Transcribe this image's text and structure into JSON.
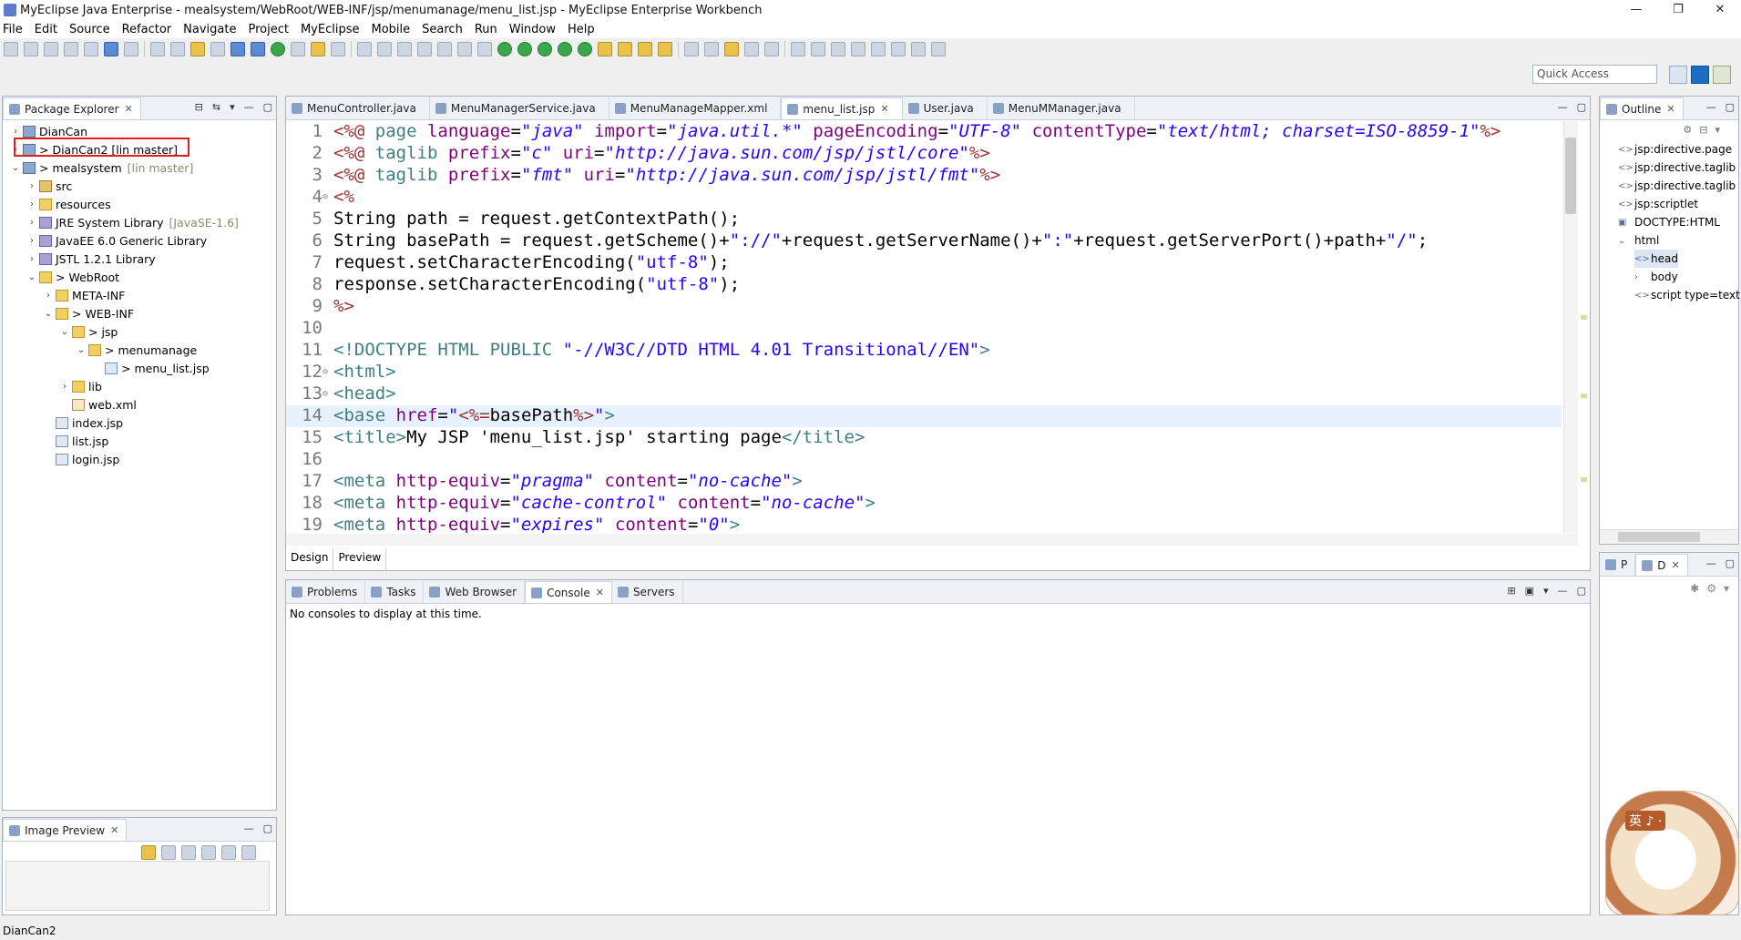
{
  "window": {
    "title": "MyEclipse Java Enterprise - mealsystem/WebRoot/WEB-INF/jsp/menumanage/menu_list.jsp - MyEclipse Enterprise Workbench",
    "controls": [
      "—",
      "❐",
      "✕"
    ]
  },
  "menu": [
    "File",
    "Edit",
    "Source",
    "Refactor",
    "Navigate",
    "Project",
    "MyEclipse",
    "Mobile",
    "Search",
    "Run",
    "Window",
    "Help"
  ],
  "quick_access": "Quick Access",
  "package_explorer": {
    "tab_label": "Package Explorer",
    "rows": [
      {
        "arrow": "›",
        "text": "DianCan",
        "suffix": ""
      },
      {
        "arrow": "›",
        "text": "> DianCan2  [lin master]",
        "suffix": ""
      },
      {
        "arrow": "⌄",
        "text": "> mealsystem",
        "suffix": "[lin master]"
      },
      {
        "arrow": "›",
        "text": "src",
        "suffix": ""
      },
      {
        "arrow": "›",
        "text": "resources",
        "suffix": ""
      },
      {
        "arrow": "›",
        "text": "JRE System Library",
        "suffix": "[JavaSE-1.6]"
      },
      {
        "arrow": "›",
        "text": "JavaEE 6.0 Generic Library",
        "suffix": ""
      },
      {
        "arrow": "›",
        "text": "JSTL 1.2.1 Library",
        "suffix": ""
      },
      {
        "arrow": "⌄",
        "text": "> WebRoot",
        "suffix": ""
      },
      {
        "arrow": "›",
        "text": "META-INF",
        "suffix": ""
      },
      {
        "arrow": "⌄",
        "text": "> WEB-INF",
        "suffix": ""
      },
      {
        "arrow": "⌄",
        "text": "> jsp",
        "suffix": ""
      },
      {
        "arrow": "⌄",
        "text": "> menumanage",
        "suffix": ""
      },
      {
        "arrow": "",
        "text": "> menu_list.jsp",
        "suffix": ""
      },
      {
        "arrow": "›",
        "text": "lib",
        "suffix": ""
      },
      {
        "arrow": "",
        "text": "web.xml",
        "suffix": ""
      },
      {
        "arrow": "",
        "text": "index.jsp",
        "suffix": ""
      },
      {
        "arrow": "",
        "text": "list.jsp",
        "suffix": ""
      },
      {
        "arrow": "",
        "text": "login.jsp",
        "suffix": ""
      }
    ]
  },
  "image_preview": {
    "tab_label": "Image Preview"
  },
  "editor": {
    "tabs": [
      {
        "label": "MenuController.java",
        "active": false
      },
      {
        "label": "MenuManagerService.java",
        "active": false
      },
      {
        "label": "MenuManageMapper.xml",
        "active": false
      },
      {
        "label": "menu_list.jsp",
        "active": true
      },
      {
        "label": "User.java",
        "active": false
      },
      {
        "label": "MenuMManager.java",
        "active": false
      }
    ],
    "bottom_tabs": [
      "Design",
      "Preview"
    ],
    "current_line": 14,
    "lines": [
      {
        "n": "1",
        "fold": "",
        "segs": [
          [
            "dir",
            "<%@ "
          ],
          [
            "kw",
            "page "
          ],
          [
            "attr",
            "language"
          ],
          [
            "",
            "="
          ],
          [
            "str",
            "\"java\""
          ],
          [
            "",
            " "
          ],
          [
            "attr",
            "import"
          ],
          [
            "",
            "="
          ],
          [
            "str",
            "\"java.util.*\""
          ],
          [
            "",
            " "
          ],
          [
            "attr",
            "pageEncoding"
          ],
          [
            "",
            "="
          ],
          [
            "str",
            "\"UTF-8\""
          ],
          [
            "",
            " "
          ],
          [
            "attr",
            "contentType"
          ],
          [
            "",
            "="
          ],
          [
            "str",
            "\"text/html; charset=ISO-8859-1\""
          ],
          [
            "dir",
            "%>"
          ]
        ]
      },
      {
        "n": "2",
        "fold": "",
        "segs": [
          [
            "dir",
            "<%@ "
          ],
          [
            "kw",
            "taglib "
          ],
          [
            "attr",
            "prefix"
          ],
          [
            "",
            "="
          ],
          [
            "str",
            "\"c\""
          ],
          [
            "",
            " "
          ],
          [
            "attr",
            "uri"
          ],
          [
            "",
            "="
          ],
          [
            "str",
            "\"http://java.sun.com/jsp/jstl/core\""
          ],
          [
            "dir",
            "%>"
          ]
        ]
      },
      {
        "n": "3",
        "fold": "",
        "segs": [
          [
            "dir",
            "<%@ "
          ],
          [
            "kw",
            "taglib "
          ],
          [
            "attr",
            "prefix"
          ],
          [
            "",
            "="
          ],
          [
            "str",
            "\"fmt\""
          ],
          [
            "",
            " "
          ],
          [
            "attr",
            "uri"
          ],
          [
            "",
            "="
          ],
          [
            "str",
            "\"http://java.sun.com/jsp/jstl/fmt\""
          ],
          [
            "dir",
            "%>"
          ]
        ]
      },
      {
        "n": "4",
        "fold": "⊖",
        "segs": [
          [
            "dir",
            "<%"
          ]
        ]
      },
      {
        "n": "5",
        "fold": "",
        "segs": [
          [
            "",
            "String path = request.getContextPath();"
          ]
        ]
      },
      {
        "n": "6",
        "fold": "",
        "segs": [
          [
            "",
            "String basePath = request.getScheme()+"
          ],
          [
            "str2",
            "\"://\""
          ],
          [
            "",
            "+request.getServerName()+"
          ],
          [
            "str2",
            "\":\""
          ],
          [
            "",
            "+request.getServerPort()+path+"
          ],
          [
            "str2",
            "\"/\""
          ],
          [
            "",
            ";"
          ]
        ]
      },
      {
        "n": "7",
        "fold": "",
        "segs": [
          [
            "",
            "request.setCharacterEncoding("
          ],
          [
            "str2",
            "\"utf-8\""
          ],
          [
            "",
            ");"
          ]
        ]
      },
      {
        "n": "8",
        "fold": "",
        "segs": [
          [
            "",
            "response.setCharacterEncoding("
          ],
          [
            "str2",
            "\"utf-8\""
          ],
          [
            "",
            ");"
          ]
        ]
      },
      {
        "n": "9",
        "fold": "",
        "segs": [
          [
            "dir",
            "%>"
          ]
        ]
      },
      {
        "n": "10",
        "fold": "",
        "segs": [
          [
            "",
            ""
          ]
        ]
      },
      {
        "n": "11",
        "fold": "",
        "segs": [
          [
            "dt",
            "<!DOCTYPE HTML PUBLIC "
          ],
          [
            "str2",
            "\"-//W3C//DTD HTML 4.01 Transitional//EN\""
          ],
          [
            "dt",
            ">"
          ]
        ]
      },
      {
        "n": "12",
        "fold": "⊖",
        "segs": [
          [
            "tag",
            "<html>"
          ]
        ]
      },
      {
        "n": "13",
        "fold": "⊖",
        "segs": [
          [
            "tag",
            "<head>"
          ]
        ]
      },
      {
        "n": "14",
        "fold": "",
        "segs": [
          [
            "tag",
            "<base "
          ],
          [
            "attr",
            "href"
          ],
          [
            "",
            "="
          ],
          [
            "str2",
            "\""
          ],
          [
            "dir",
            "<%="
          ],
          [
            "",
            "basePath"
          ],
          [
            "dir",
            "%>"
          ],
          [
            "str2",
            "\""
          ],
          [
            "tag",
            ">"
          ]
        ]
      },
      {
        "n": "15",
        "fold": "",
        "segs": [
          [
            "tag",
            "<title>"
          ],
          [
            "",
            "My JSP 'menu_list.jsp' starting page"
          ],
          [
            "tag",
            "</title>"
          ]
        ]
      },
      {
        "n": "16",
        "fold": "",
        "segs": [
          [
            "",
            ""
          ]
        ]
      },
      {
        "n": "17",
        "fold": "",
        "segs": [
          [
            "tag",
            "<meta "
          ],
          [
            "attr",
            "http-equiv"
          ],
          [
            "",
            "="
          ],
          [
            "str",
            "\"pragma\""
          ],
          [
            "",
            " "
          ],
          [
            "attr",
            "content"
          ],
          [
            "",
            "="
          ],
          [
            "str",
            "\"no-cache\""
          ],
          [
            "tag",
            ">"
          ]
        ]
      },
      {
        "n": "18",
        "fold": "",
        "segs": [
          [
            "tag",
            "<meta "
          ],
          [
            "attr",
            "http-equiv"
          ],
          [
            "",
            "="
          ],
          [
            "str",
            "\"cache-control\""
          ],
          [
            "",
            " "
          ],
          [
            "attr",
            "content"
          ],
          [
            "",
            "="
          ],
          [
            "str",
            "\"no-cache\""
          ],
          [
            "tag",
            ">"
          ]
        ]
      },
      {
        "n": "19",
        "fold": "",
        "segs": [
          [
            "tag",
            "<meta "
          ],
          [
            "attr",
            "http-equiv"
          ],
          [
            "",
            "="
          ],
          [
            "str",
            "\"expires\""
          ],
          [
            "",
            " "
          ],
          [
            "attr",
            "content"
          ],
          [
            "",
            "="
          ],
          [
            "str",
            "\"0\""
          ],
          [
            "tag",
            ">"
          ]
        ]
      }
    ]
  },
  "outline": {
    "tab_label": "Outline",
    "rows": [
      {
        "icon": "<>",
        "text": "jsp:directive.page",
        "indent": 0
      },
      {
        "icon": "<>",
        "text": "jsp:directive.taglib",
        "indent": 0
      },
      {
        "icon": "<>",
        "text": "jsp:directive.taglib",
        "indent": 0
      },
      {
        "icon": "<>",
        "text": "jsp:scriptlet",
        "indent": 0
      },
      {
        "icon": "▣",
        "text": "DOCTYPE:HTML",
        "indent": 0
      },
      {
        "icon": "⌄",
        "text": "html",
        "indent": 0
      },
      {
        "icon": "<>",
        "text": "head",
        "indent": 1
      },
      {
        "icon": "›",
        "text": "body",
        "indent": 1
      },
      {
        "icon": "<>",
        "text": "script type=text",
        "indent": 1
      }
    ]
  },
  "small_panel": {
    "tabs": [
      "P",
      "D"
    ]
  },
  "mascot": {
    "label": "英 ♪ ·"
  },
  "console_panel": {
    "tabs": [
      "Problems",
      "Tasks",
      "Web Browser",
      "Console",
      "Servers"
    ],
    "active": "Console",
    "message": "No consoles to display at this time."
  },
  "status": {
    "text": "DianCan2"
  },
  "colors": {
    "highlight_box": "#e02020",
    "current_line": "#e8f2fe",
    "string": "#2a00ff",
    "directive": "#9e3232"
  }
}
